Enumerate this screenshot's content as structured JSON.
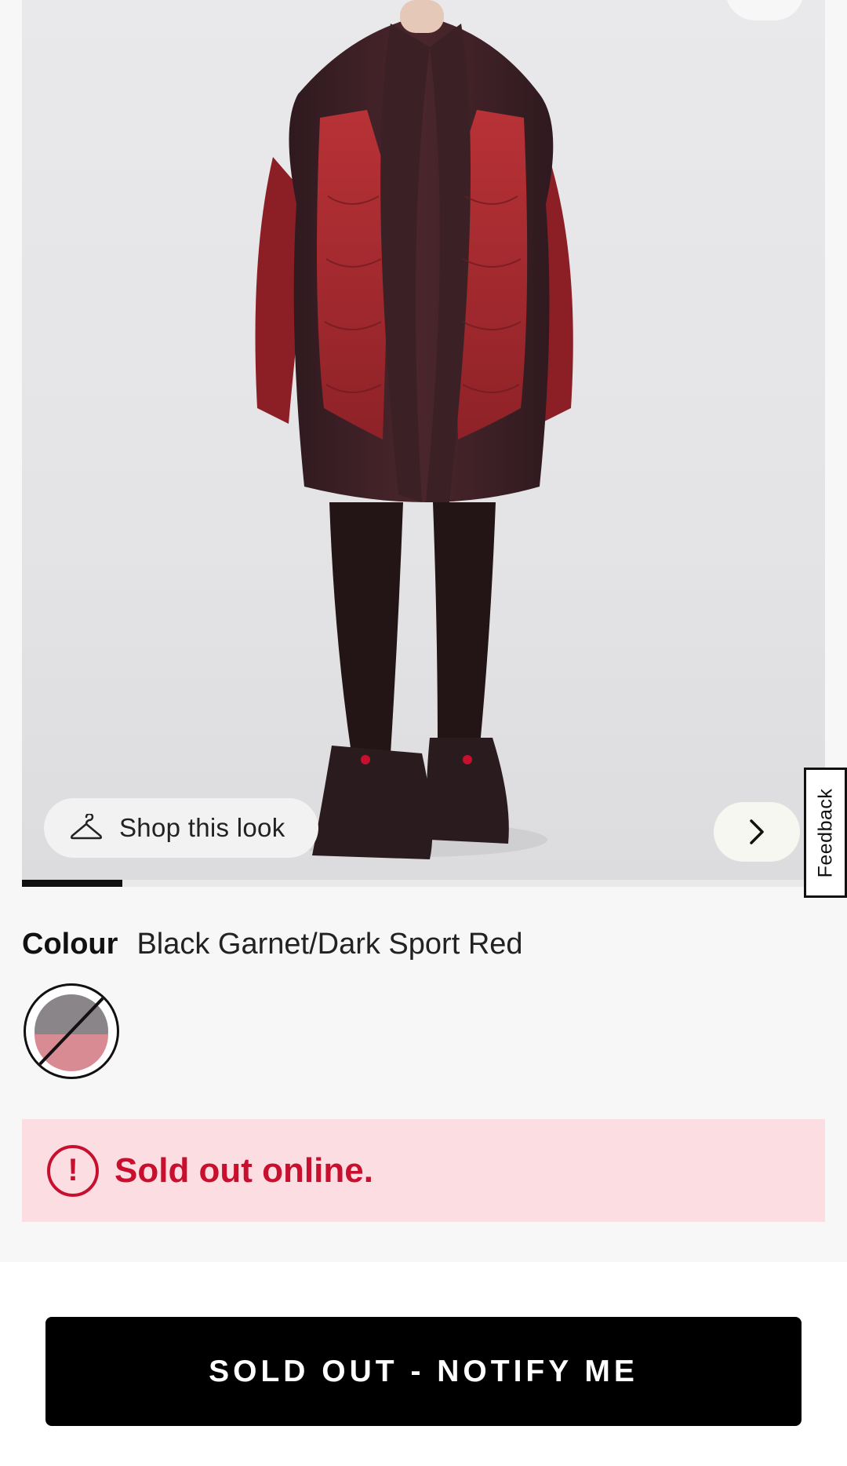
{
  "gallery": {
    "shop_look_label": "Shop this look",
    "progress_fraction": 0.125
  },
  "feedback_label": "Feedback",
  "colour": {
    "label": "Colour",
    "value": "Black Garnet/Dark Sport Red",
    "swatch_state": "unavailable"
  },
  "availability": {
    "alert_symbol": "!",
    "message": "Sold out online."
  },
  "cta": {
    "label": "SOLD OUT - NOTIFY ME"
  },
  "colors": {
    "alert_red": "#c8102e",
    "banner_bg": "#fbdde2",
    "garnet": "#3a2025",
    "sport_red": "#a92a2d"
  }
}
